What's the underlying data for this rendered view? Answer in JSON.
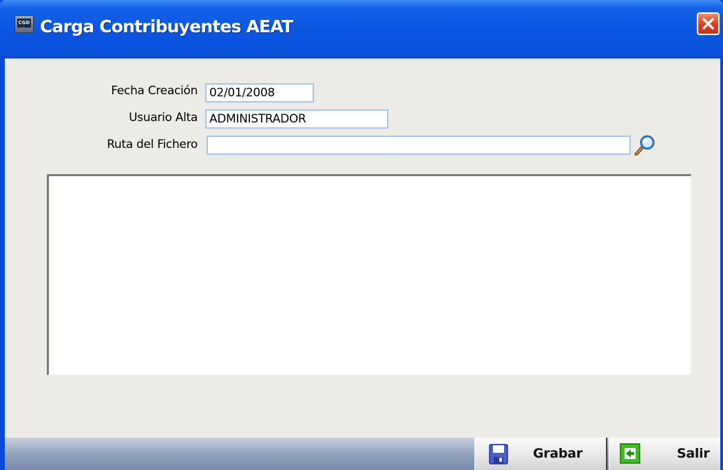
{
  "window": {
    "title": "Carga Contribuyentes AEAT",
    "app_icon_text": "CGD"
  },
  "form": {
    "fecha_creacion_label": "Fecha Creación",
    "fecha_creacion_value": "02/01/2008",
    "usuario_alta_label": "Usuario Alta",
    "usuario_alta_value": "ADMINISTRADOR",
    "ruta_fichero_label": "Ruta del Fichero",
    "ruta_fichero_value": ""
  },
  "toolbar": {
    "grabar_label": "Grabar",
    "salir_label": "Salir"
  },
  "colors": {
    "titlebar": "#0a55e2",
    "client_bg": "#ecebe6",
    "field_border": "#a7c5ea",
    "close": "#d6401d"
  },
  "icons": [
    "app-icon",
    "close-icon",
    "search-icon",
    "save-icon",
    "exit-icon"
  ]
}
